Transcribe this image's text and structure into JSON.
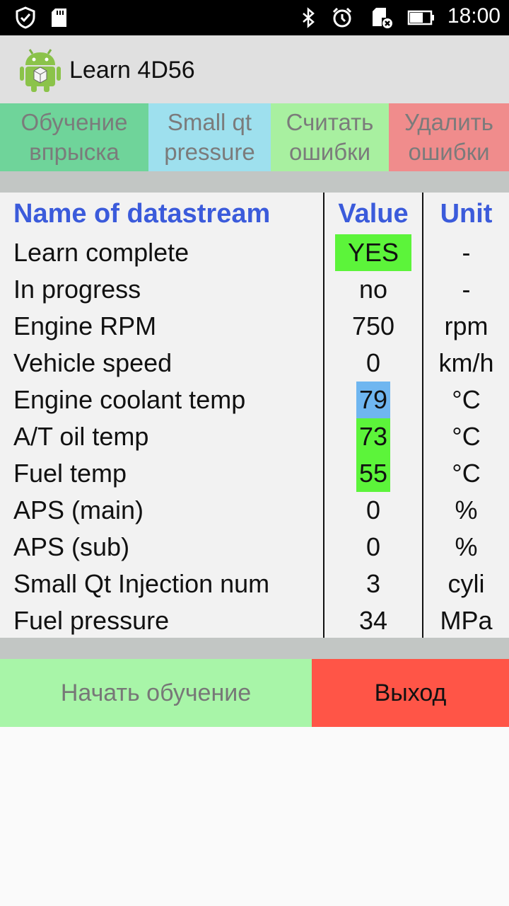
{
  "status_bar": {
    "time": "18:00",
    "icons": [
      "shield-check-icon",
      "sd-card-icon",
      "bluetooth-icon",
      "alarm-icon",
      "sd-card-error-icon",
      "battery-icon"
    ]
  },
  "app_bar": {
    "icon": "android-icon",
    "title": "Learn 4D56"
  },
  "tabs": [
    {
      "line1": "Обучение",
      "line2": "впрыска",
      "color": "#6fd49a"
    },
    {
      "line1": "Small qt",
      "line2": "pressure",
      "color": "#9ee0ee"
    },
    {
      "line1": "Считать",
      "line2": "ошибки",
      "color": "#a8f0a0"
    },
    {
      "line1": "Удалить",
      "line2": "ошибки",
      "color": "#f08c8c"
    }
  ],
  "table": {
    "headers": {
      "name": "Name of datastream",
      "value": "Value",
      "unit": "Unit"
    },
    "header_color": "#3b5bdb",
    "rows": [
      {
        "name": "Learn complete",
        "value": "YES",
        "unit": "-",
        "highlight": "#5cf43a"
      },
      {
        "name": "In progress",
        "value": "no",
        "unit": "-"
      },
      {
        "name": "Engine RPM",
        "value": "750",
        "unit": "rpm"
      },
      {
        "name": "Vehicle speed",
        "value": "0",
        "unit": "km/h"
      },
      {
        "name": "Engine coolant temp",
        "value": "79",
        "unit": "°C",
        "highlight": "#6fb6f0"
      },
      {
        "name": "A/T oil temp",
        "value": "73",
        "unit": "°C",
        "highlight": "#5cf43a"
      },
      {
        "name": "Fuel temp",
        "value": "55",
        "unit": "°C",
        "highlight": "#5cf43a"
      },
      {
        "name": "APS (main)",
        "value": "0",
        "unit": "%"
      },
      {
        "name": "APS (sub)",
        "value": "0",
        "unit": "%"
      },
      {
        "name": "Small Qt Injection num",
        "value": "3",
        "unit": "cyli"
      },
      {
        "name": "Fuel pressure",
        "value": "34",
        "unit": "MPa"
      }
    ]
  },
  "buttons": {
    "start_label": "Начать обучение",
    "start_color": "#a8f5a8",
    "exit_label": "Выход",
    "exit_color": "#ff5547"
  }
}
